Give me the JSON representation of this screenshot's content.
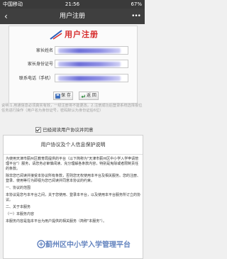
{
  "statusbar": {
    "carrier": "中国移动",
    "time": "21:56",
    "battery": "67%"
  },
  "navbar": {
    "back": "‹",
    "title": "用户注册",
    "more": "•••"
  },
  "form": {
    "logo_text": "用户注册",
    "fields": [
      {
        "label": "家长姓名"
      },
      {
        "label": "家长身份证号"
      },
      {
        "label": "联系电话（手机）"
      }
    ],
    "save_label": "保 存",
    "back_label": "返 回"
  },
  "notice": "说明:1.用通信息必须真实有效，一经注册将不能更改。2.注册成功后登录系统选择报位任务进行操作（用户名为身份证号，密码默认为身份证后6位）",
  "agree_label": "已经阅读用户协议并同意",
  "agreement": {
    "title": "用户协议及个人信息保护说明",
    "paragraphs": [
      "为使用天津市蓟州区教育局提供的平台（以下简称为\"天津市蓟州区中小学入学申请管理平台\"）服务，请您务必审慎阅读、充分理解各条款内容，特别是免除或者限制责任的条款。",
      "除非您已阅读并接受本协议所有条款，否则您无权使用本平台及相关服务。您的注册、登录、使用等行为即视为您已阅读并同意本协议的约束。",
      "一、协议的范围",
      "本协议是您与本平台之间，关于您使用、登录本平台，以及使用本平台服务所订立的协议。",
      "二、关于本服务",
      "（一）本服务内容",
      "本服务内容是指本平台为用户提供的相关服务（简称\"本服务\"）。"
    ]
  },
  "watermark": "蓟州区中小学入学管理平台"
}
